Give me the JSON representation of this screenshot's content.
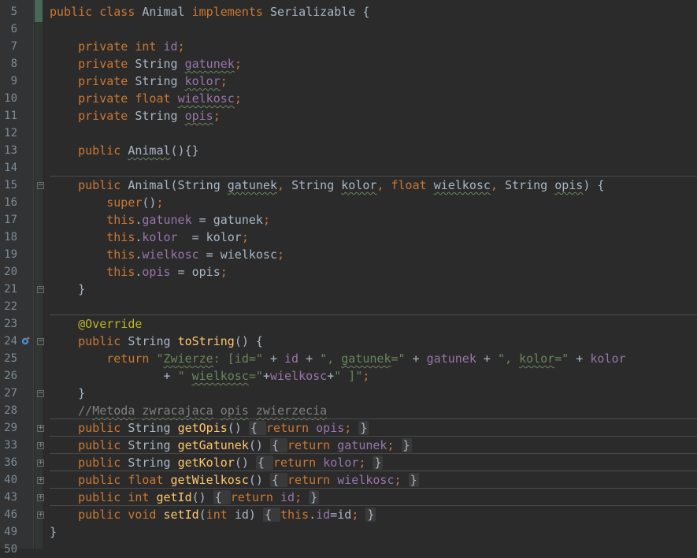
{
  "lines": [
    {
      "n": "5",
      "tokens": [
        [
          "kw",
          "public class "
        ],
        [
          "plain",
          "Animal "
        ],
        [
          "kw",
          "implements "
        ],
        [
          "plain",
          "Serializable {"
        ]
      ]
    },
    {
      "n": "6",
      "tokens": []
    },
    {
      "n": "7",
      "tokens": [
        [
          "plain",
          "    "
        ],
        [
          "kw",
          "private int "
        ],
        [
          "fld",
          "id"
        ],
        [
          "kw",
          ";"
        ]
      ]
    },
    {
      "n": "8",
      "tokens": [
        [
          "plain",
          "    "
        ],
        [
          "kw",
          "private "
        ],
        [
          "plain",
          "String "
        ],
        [
          "fld wavy",
          "gatunek"
        ],
        [
          "kw",
          ";"
        ]
      ]
    },
    {
      "n": "9",
      "tokens": [
        [
          "plain",
          "    "
        ],
        [
          "kw",
          "private "
        ],
        [
          "plain",
          "String "
        ],
        [
          "fld wavy",
          "kolor"
        ],
        [
          "kw",
          ";"
        ]
      ]
    },
    {
      "n": "10",
      "tokens": [
        [
          "plain",
          "    "
        ],
        [
          "kw",
          "private float "
        ],
        [
          "fld wavy",
          "wielkosc"
        ],
        [
          "kw",
          ";"
        ]
      ]
    },
    {
      "n": "11",
      "tokens": [
        [
          "plain",
          "    "
        ],
        [
          "kw",
          "private "
        ],
        [
          "plain",
          "String "
        ],
        [
          "fld wavy",
          "opis"
        ],
        [
          "kw",
          ";"
        ]
      ]
    },
    {
      "n": "12",
      "tokens": []
    },
    {
      "n": "13",
      "tokens": [
        [
          "plain",
          "    "
        ],
        [
          "kw",
          "public "
        ],
        [
          "plain wavy",
          "Animal"
        ],
        [
          "plain",
          "(){}"
        ]
      ]
    },
    {
      "n": "14",
      "tokens": []
    },
    {
      "n": "15",
      "fold": "-",
      "tokens": [
        [
          "plain",
          "    "
        ],
        [
          "kw",
          "public "
        ],
        [
          "plain",
          "Animal(String "
        ],
        [
          "plain wavy",
          "gatunek"
        ],
        [
          "kw",
          ", "
        ],
        [
          "plain",
          "String "
        ],
        [
          "plain wavy",
          "kolor"
        ],
        [
          "kw",
          ", float "
        ],
        [
          "plain wavy",
          "wielkosc"
        ],
        [
          "kw",
          ", "
        ],
        [
          "plain",
          "String "
        ],
        [
          "plain wavy",
          "opis"
        ],
        [
          "plain",
          ") {"
        ]
      ]
    },
    {
      "n": "16",
      "tokens": [
        [
          "plain",
          "        "
        ],
        [
          "kw",
          "super"
        ],
        [
          "plain",
          "()"
        ],
        [
          "kw",
          ";"
        ]
      ]
    },
    {
      "n": "17",
      "tokens": [
        [
          "plain",
          "        "
        ],
        [
          "kw",
          "this"
        ],
        [
          "plain",
          "."
        ],
        [
          "fld",
          "gatunek"
        ],
        [
          "plain",
          " = gatunek"
        ],
        [
          "kw",
          ";"
        ]
      ]
    },
    {
      "n": "18",
      "tokens": [
        [
          "plain",
          "        "
        ],
        [
          "kw",
          "this"
        ],
        [
          "plain",
          "."
        ],
        [
          "fld",
          "kolor"
        ],
        [
          "plain",
          "  = kolor"
        ],
        [
          "kw",
          ";"
        ]
      ]
    },
    {
      "n": "19",
      "tokens": [
        [
          "plain",
          "        "
        ],
        [
          "kw",
          "this"
        ],
        [
          "plain",
          "."
        ],
        [
          "fld",
          "wielkosc"
        ],
        [
          "plain",
          " = wielkosc"
        ],
        [
          "kw",
          ";"
        ]
      ]
    },
    {
      "n": "20",
      "tokens": [
        [
          "plain",
          "        "
        ],
        [
          "kw",
          "this"
        ],
        [
          "plain",
          "."
        ],
        [
          "fld",
          "opis"
        ],
        [
          "plain",
          " = opis"
        ],
        [
          "kw",
          ";"
        ]
      ]
    },
    {
      "n": "21",
      "fold": "end",
      "tokens": [
        [
          "plain",
          "    }"
        ]
      ]
    },
    {
      "n": "22",
      "tokens": []
    },
    {
      "n": "23",
      "tokens": [
        [
          "plain",
          "    "
        ],
        [
          "ann",
          "@Override"
        ]
      ]
    },
    {
      "n": "24",
      "fold": "-",
      "override": true,
      "tokens": [
        [
          "plain",
          "    "
        ],
        [
          "kw",
          "public "
        ],
        [
          "plain",
          "String "
        ],
        [
          "fn",
          "toString"
        ],
        [
          "plain",
          "() {"
        ]
      ]
    },
    {
      "n": "25",
      "tokens": [
        [
          "plain",
          "        "
        ],
        [
          "kw",
          "return "
        ],
        [
          "str",
          "\""
        ],
        [
          "str wavy",
          "Zwierze"
        ],
        [
          "str",
          ": [id=\""
        ],
        [
          "plain",
          " + "
        ],
        [
          "fld",
          "id"
        ],
        [
          "plain",
          " + "
        ],
        [
          "str",
          "\", "
        ],
        [
          "str wavy",
          "gatunek"
        ],
        [
          "str",
          "=\""
        ],
        [
          "plain",
          " + "
        ],
        [
          "fld",
          "gatunek"
        ],
        [
          "plain",
          " + "
        ],
        [
          "str",
          "\", "
        ],
        [
          "str wavy",
          "kolor"
        ],
        [
          "str",
          "=\""
        ],
        [
          "plain",
          " + "
        ],
        [
          "fld",
          "kolor"
        ]
      ]
    },
    {
      "n": "26",
      "tokens": [
        [
          "plain",
          "                "
        ],
        [
          "plain",
          "+ "
        ],
        [
          "str",
          "\" "
        ],
        [
          "str wavy",
          "wielkosc"
        ],
        [
          "str",
          "=\""
        ],
        [
          "plain",
          "+"
        ],
        [
          "fld",
          "wielkosc"
        ],
        [
          "plain",
          "+"
        ],
        [
          "str",
          "\" ]\""
        ],
        [
          "kw",
          ";"
        ]
      ]
    },
    {
      "n": "27",
      "fold": "end",
      "tokens": [
        [
          "plain",
          "    }"
        ]
      ]
    },
    {
      "n": "28",
      "tokens": [
        [
          "plain",
          "    "
        ],
        [
          "cmt",
          "//"
        ],
        [
          "cmt wavy",
          "Metoda"
        ],
        [
          "cmt",
          " "
        ],
        [
          "cmt wavy",
          "zwracajaca"
        ],
        [
          "cmt",
          " "
        ],
        [
          "cmt wavy",
          "opis"
        ],
        [
          "cmt",
          " "
        ],
        [
          "cmt wavy",
          "zwierzecia"
        ]
      ]
    },
    {
      "n": "29",
      "fold": "+",
      "tokens": [
        [
          "plain",
          "    "
        ],
        [
          "kw",
          "public "
        ],
        [
          "plain",
          "String "
        ],
        [
          "fn",
          "getOpis"
        ],
        [
          "plain",
          "() "
        ],
        [
          "collapsed",
          "{ "
        ],
        [
          "kw",
          "return "
        ],
        [
          "fld",
          "opis"
        ],
        [
          "kw",
          "; "
        ],
        [
          "collapsed",
          "}"
        ]
      ]
    },
    {
      "n": "33",
      "fold": "+",
      "tokens": [
        [
          "plain",
          "    "
        ],
        [
          "kw",
          "public "
        ],
        [
          "plain",
          "String "
        ],
        [
          "fn",
          "getGatunek"
        ],
        [
          "plain",
          "() "
        ],
        [
          "collapsed",
          "{ "
        ],
        [
          "kw",
          "return "
        ],
        [
          "fld",
          "gatunek"
        ],
        [
          "kw",
          "; "
        ],
        [
          "collapsed",
          "}"
        ]
      ]
    },
    {
      "n": "36",
      "fold": "+",
      "tokens": [
        [
          "plain",
          "    "
        ],
        [
          "kw",
          "public "
        ],
        [
          "plain",
          "String "
        ],
        [
          "fn",
          "getKolor"
        ],
        [
          "plain",
          "() "
        ],
        [
          "collapsed",
          "{ "
        ],
        [
          "kw",
          "return "
        ],
        [
          "fld",
          "kolor"
        ],
        [
          "kw",
          "; "
        ],
        [
          "collapsed",
          "}"
        ]
      ]
    },
    {
      "n": "40",
      "fold": "+",
      "tokens": [
        [
          "plain",
          "    "
        ],
        [
          "kw",
          "public float "
        ],
        [
          "fn",
          "getWielkosc"
        ],
        [
          "plain",
          "() "
        ],
        [
          "collapsed",
          "{ "
        ],
        [
          "kw",
          "return "
        ],
        [
          "fld",
          "wielkosc"
        ],
        [
          "kw",
          "; "
        ],
        [
          "collapsed",
          "}"
        ]
      ]
    },
    {
      "n": "43",
      "fold": "+",
      "tokens": [
        [
          "plain",
          "    "
        ],
        [
          "kw",
          "public int "
        ],
        [
          "fn",
          "getId"
        ],
        [
          "plain",
          "() "
        ],
        [
          "collapsed",
          "{ "
        ],
        [
          "kw",
          "return "
        ],
        [
          "fld",
          "id"
        ],
        [
          "kw",
          "; "
        ],
        [
          "collapsed",
          "}"
        ]
      ]
    },
    {
      "n": "46",
      "fold": "+",
      "tokens": [
        [
          "plain",
          "    "
        ],
        [
          "kw",
          "public void "
        ],
        [
          "fn",
          "setId"
        ],
        [
          "plain",
          "("
        ],
        [
          "kw",
          "int "
        ],
        [
          "plain",
          "id) "
        ],
        [
          "collapsed",
          "{ "
        ],
        [
          "kw",
          "this"
        ],
        [
          "plain",
          "."
        ],
        [
          "fld",
          "id"
        ],
        [
          "plain",
          "=id"
        ],
        [
          "kw",
          "; "
        ],
        [
          "collapsed",
          "}"
        ]
      ]
    },
    {
      "n": "49",
      "tokens": [
        [
          "plain",
          "}"
        ]
      ]
    },
    {
      "n": "50",
      "tokens": []
    }
  ]
}
